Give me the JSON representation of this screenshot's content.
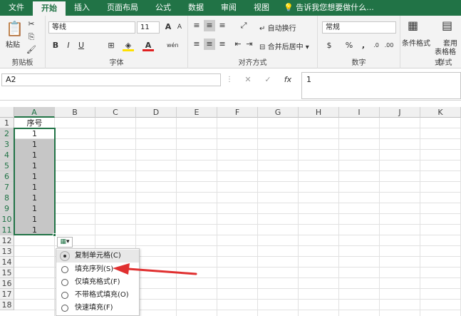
{
  "tabs": [
    "文件",
    "开始",
    "插入",
    "页面布局",
    "公式",
    "数据",
    "审阅",
    "视图"
  ],
  "tellme": "告诉我您想要做什么...",
  "clipboard": {
    "paste_label": "粘贴",
    "group_label": "剪贴板"
  },
  "font": {
    "name": "等线",
    "size": "11",
    "group_label": "字体",
    "bold": "B",
    "italic": "I",
    "underline": "U",
    "grow": "A",
    "shrink": "A",
    "wen": "wén"
  },
  "alignment": {
    "wrap_label": "自动换行",
    "merge_label": "合并后居中",
    "group_label": "对齐方式"
  },
  "number": {
    "format": "常规",
    "group_label": "数字",
    "currency": "$",
    "percent": "%",
    "comma": ","
  },
  "styles": {
    "conditional_label": "条件格式",
    "table_label_1": "套用",
    "table_label_2": "表格格式",
    "group_label": "样式"
  },
  "formula_bar": {
    "name_box": "A2",
    "cancel": "✕",
    "enter": "✓",
    "fx": "fx",
    "content": "1"
  },
  "columns": [
    "A",
    "B",
    "C",
    "D",
    "E",
    "F",
    "G",
    "H",
    "I",
    "J",
    "K"
  ],
  "rows": [
    "1",
    "2",
    "3",
    "4",
    "5",
    "6",
    "7",
    "8",
    "9",
    "10",
    "11",
    "12",
    "13",
    "14",
    "15",
    "16",
    "17",
    "18"
  ],
  "cells": {
    "A1": "序号",
    "A2_A11": [
      "1",
      "1",
      "1",
      "1",
      "1",
      "1",
      "1",
      "1",
      "1",
      "1"
    ]
  },
  "autofill_button": "▾",
  "autofill_menu": [
    {
      "label": "复制单元格(C)",
      "selected": true
    },
    {
      "label": "填充序列(S)",
      "selected": false
    },
    {
      "label": "仅填充格式(F)",
      "selected": false
    },
    {
      "label": "不带格式填充(O)",
      "selected": false
    },
    {
      "label": "快速填充(F)",
      "selected": false
    }
  ],
  "colors": {
    "accent": "#217346",
    "arrow": "#e03030",
    "font_color": "#e02020",
    "fill_color": "#ffe000"
  }
}
